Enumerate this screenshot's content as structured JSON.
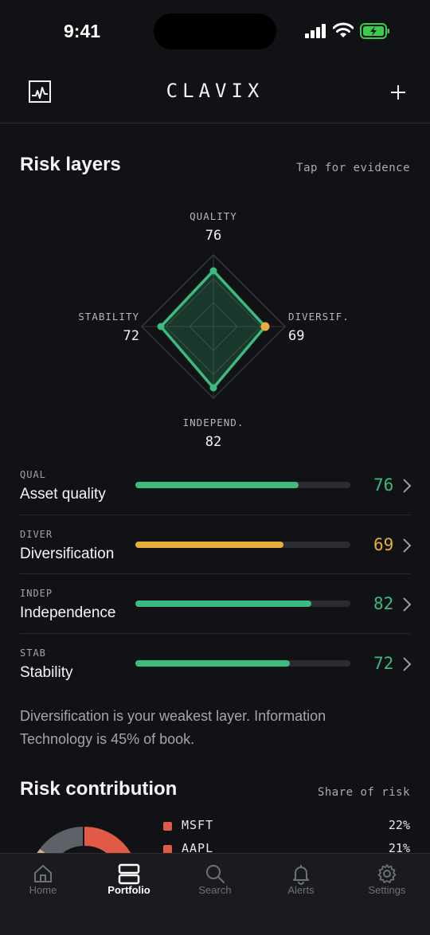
{
  "status_bar": {
    "time": "9:41"
  },
  "header": {
    "brand": "CLAVIX"
  },
  "risk_layers": {
    "title": "Risk layers",
    "hint": "Tap for evidence",
    "radar": {
      "quality": {
        "label": "QUALITY",
        "value": "76"
      },
      "diversification": {
        "label": "DIVERSIF.",
        "value": "69"
      },
      "independence": {
        "label": "INDEPEND.",
        "value": "82"
      },
      "stability": {
        "label": "STABILITY",
        "value": "72"
      }
    },
    "layers": [
      {
        "code": "QUAL",
        "name": "Asset quality",
        "score": "76",
        "fraction": 0.76,
        "color": "#3dba7e"
      },
      {
        "code": "DIVER",
        "name": "Diversification",
        "score": "69",
        "fraction": 0.69,
        "color": "#e8ad3c"
      },
      {
        "code": "INDEP",
        "name": "Independence",
        "score": "82",
        "fraction": 0.82,
        "color": "#3dba7e"
      },
      {
        "code": "STAB",
        "name": "Stability",
        "score": "72",
        "fraction": 0.72,
        "color": "#3dba7e"
      }
    ],
    "insight": "Diversification is your weakest layer. Information Technology is 45% of book."
  },
  "risk_contribution": {
    "title": "Risk contribution",
    "hint": "Share of risk",
    "items": [
      {
        "ticker": "MSFT",
        "share": "22%",
        "color": "#e05a47"
      },
      {
        "ticker": "AAPL",
        "share": "21%",
        "color": "#e05a47"
      }
    ]
  },
  "tabs": [
    {
      "label": "Home",
      "icon": "home-icon",
      "active": false
    },
    {
      "label": "Portfolio",
      "icon": "portfolio-icon",
      "active": true
    },
    {
      "label": "Search",
      "icon": "search-icon",
      "active": false
    },
    {
      "label": "Alerts",
      "icon": "bell-icon",
      "active": false
    },
    {
      "label": "Settings",
      "icon": "gear-icon",
      "active": false
    }
  ],
  "colors": {
    "accent_green": "#3dba7e",
    "accent_amber": "#e8ad3c",
    "background": "#111215"
  }
}
